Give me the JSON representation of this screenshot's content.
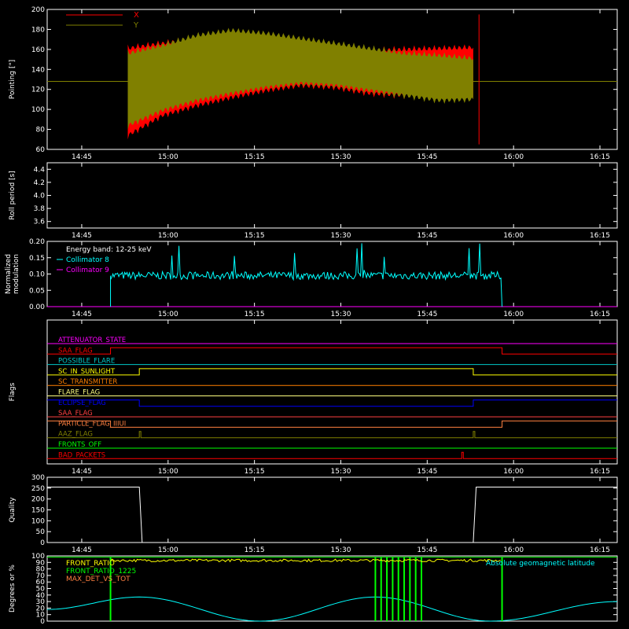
{
  "chart_data": [
    {
      "type": "area",
      "ylabel": "Pointing [\"]",
      "ylim": [
        60,
        200
      ],
      "yticks": [
        60,
        80,
        100,
        120,
        140,
        160,
        180,
        200
      ],
      "xticks": [
        "14:45",
        "15:00",
        "15:15",
        "15:30",
        "15:45",
        "16:00",
        "16:15"
      ],
      "legend": "top-left",
      "series": [
        {
          "name": "X",
          "color": "#ff0000",
          "start": "14:53",
          "end": "15:53",
          "upper_envelope": [
            165,
            170,
            175,
            172,
            168,
            165,
            163,
            163,
            164,
            165,
            166
          ],
          "lower_envelope": [
            70,
            90,
            100,
            108,
            115,
            120,
            118,
            112,
            110,
            108,
            108
          ]
        },
        {
          "name": "Y",
          "color": "#808000",
          "start": "14:53",
          "end": "15:53",
          "upper_envelope": [
            160,
            168,
            178,
            183,
            180,
            175,
            170,
            165,
            160,
            158,
            155
          ],
          "lower_envelope": [
            80,
            95,
            105,
            112,
            118,
            122,
            120,
            115,
            110,
            105,
            106
          ],
          "baseline": 128
        }
      ]
    },
    {
      "type": "line",
      "ylabel": "Roll period [s]",
      "ylim": [
        3.5,
        4.5
      ],
      "yticks": [
        3.6,
        3.8,
        4.0,
        4.2,
        4.4
      ],
      "xticks": [
        "14:45",
        "15:00",
        "15:15",
        "15:30",
        "15:45",
        "16:00",
        "16:15"
      ],
      "series": []
    },
    {
      "type": "line",
      "ylabel": [
        "Normalized",
        "modulation"
      ],
      "ylim": [
        0,
        0.2
      ],
      "yticks": [
        "0.00",
        "0.05",
        "0.10",
        "0.15",
        "0.20"
      ],
      "xticks": [
        "14:45",
        "15:00",
        "15:15",
        "15:30",
        "15:45",
        "16:00",
        "16:15"
      ],
      "legend": "top-left",
      "annotation": "Energy band: 12-25 keV",
      "series": [
        {
          "name": "Collimator 8",
          "color": "#00ffff",
          "start": "14:50",
          "end": "15:58",
          "mean": 0.095,
          "noise": 0.012,
          "spike_max": 0.195
        },
        {
          "name": "Collimator 9",
          "color": "#ff00ff",
          "value": 0
        }
      ]
    },
    {
      "type": "line",
      "ylabel": "Flags",
      "xticks": [
        "14:45",
        "15:00",
        "15:15",
        "15:30",
        "15:45",
        "16:00",
        "16:15"
      ],
      "series": [
        {
          "name": "ATTENUATOR_STATE",
          "color": "#ff00ff",
          "steps": []
        },
        {
          "name": "SAA_FLAG_",
          "color": "#ff0000",
          "steps": [
            [
              "14:50",
              "15:58"
            ]
          ]
        },
        {
          "name": "POSSIBLE_FLARE",
          "color": "#00c8c8",
          "steps": []
        },
        {
          "name": "SC_IN_SUNLIGHT",
          "color": "#ffff00",
          "steps": [
            [
              "14:55",
              "15:53"
            ]
          ]
        },
        {
          "name": "SC_TRANSMITTER",
          "color": "#ff8000",
          "steps": []
        },
        {
          "name": "FLARE_FLAG",
          "color": "#ffff80",
          "steps": []
        },
        {
          "name": "ECLIPSE_FLAG",
          "color": "#0000ff",
          "steps": [
            [
              "14:55",
              "15:53"
            ]
          ],
          "inverted": true
        },
        {
          "name": "SAA_FLAG",
          "color": "#ff4040",
          "steps": []
        },
        {
          "name": "PARTICLE_FLAG_IIIUI",
          "color": "#ff8040",
          "steps": [
            [
              "14:50",
              "15:58"
            ]
          ],
          "inverted": true
        },
        {
          "name": "AAZ_FLAG",
          "color": "#808000",
          "steps": [
            [
              "14:55",
              "14:55"
            ],
            [
              "15:53",
              "15:53"
            ]
          ]
        },
        {
          "name": "FRONTS_OFF",
          "color": "#00ff00",
          "steps": []
        },
        {
          "name": "BAD_PACKETS",
          "color": "#ff0000",
          "steps": [
            [
              "15:51",
              "15:51"
            ]
          ]
        }
      ]
    },
    {
      "type": "line",
      "ylabel": "Quality",
      "ylim": [
        0,
        300
      ],
      "yticks": [
        0,
        50,
        100,
        150,
        200,
        250,
        300
      ],
      "xticks": [
        "14:45",
        "15:00",
        "15:15",
        "15:30",
        "15:45",
        "16:00",
        "16:15"
      ],
      "series": [
        {
          "name": "",
          "color": "#ffffff",
          "points": [
            [
              "14:39",
              255
            ],
            [
              "14:55",
              255
            ],
            [
              "14:55.5",
              0
            ],
            [
              "15:53",
              0
            ],
            [
              "15:53.5",
              255
            ],
            [
              "16:18",
              255
            ]
          ]
        }
      ]
    },
    {
      "type": "line",
      "ylabel": "Degrees or %",
      "ylim": [
        0,
        100
      ],
      "yticks": [
        0,
        10,
        20,
        30,
        40,
        50,
        60,
        70,
        80,
        90,
        100
      ],
      "xticks": [],
      "legend": "top-left",
      "annotation": "Absolute geomagnetic latitude",
      "series": [
        {
          "name": "FRONT_RATIO",
          "color": "#ffff00",
          "start": "14:50",
          "end": "15:58",
          "approx": 93
        },
        {
          "name": "FRONT_RATIO_1225",
          "color": "#00ff00",
          "spikes_at": [
            "14:50",
            "15:36",
            "15:37",
            "15:38",
            "15:39",
            "15:40",
            "15:41",
            "15:42",
            "15:43",
            "15:44",
            "15:58"
          ]
        },
        {
          "name": "MAX_DET_VS_TOT",
          "color": "#ff8040",
          "values": []
        },
        {
          "name": "Absolute geomagnetic latitude",
          "color": "#00ffff",
          "points": [
            [
              "14:39",
              18
            ],
            [
              "14:55",
              37
            ],
            [
              "15:16",
              0
            ],
            [
              "15:36",
              37
            ],
            [
              "15:56",
              0
            ],
            [
              "16:18",
              30
            ]
          ]
        }
      ]
    }
  ]
}
